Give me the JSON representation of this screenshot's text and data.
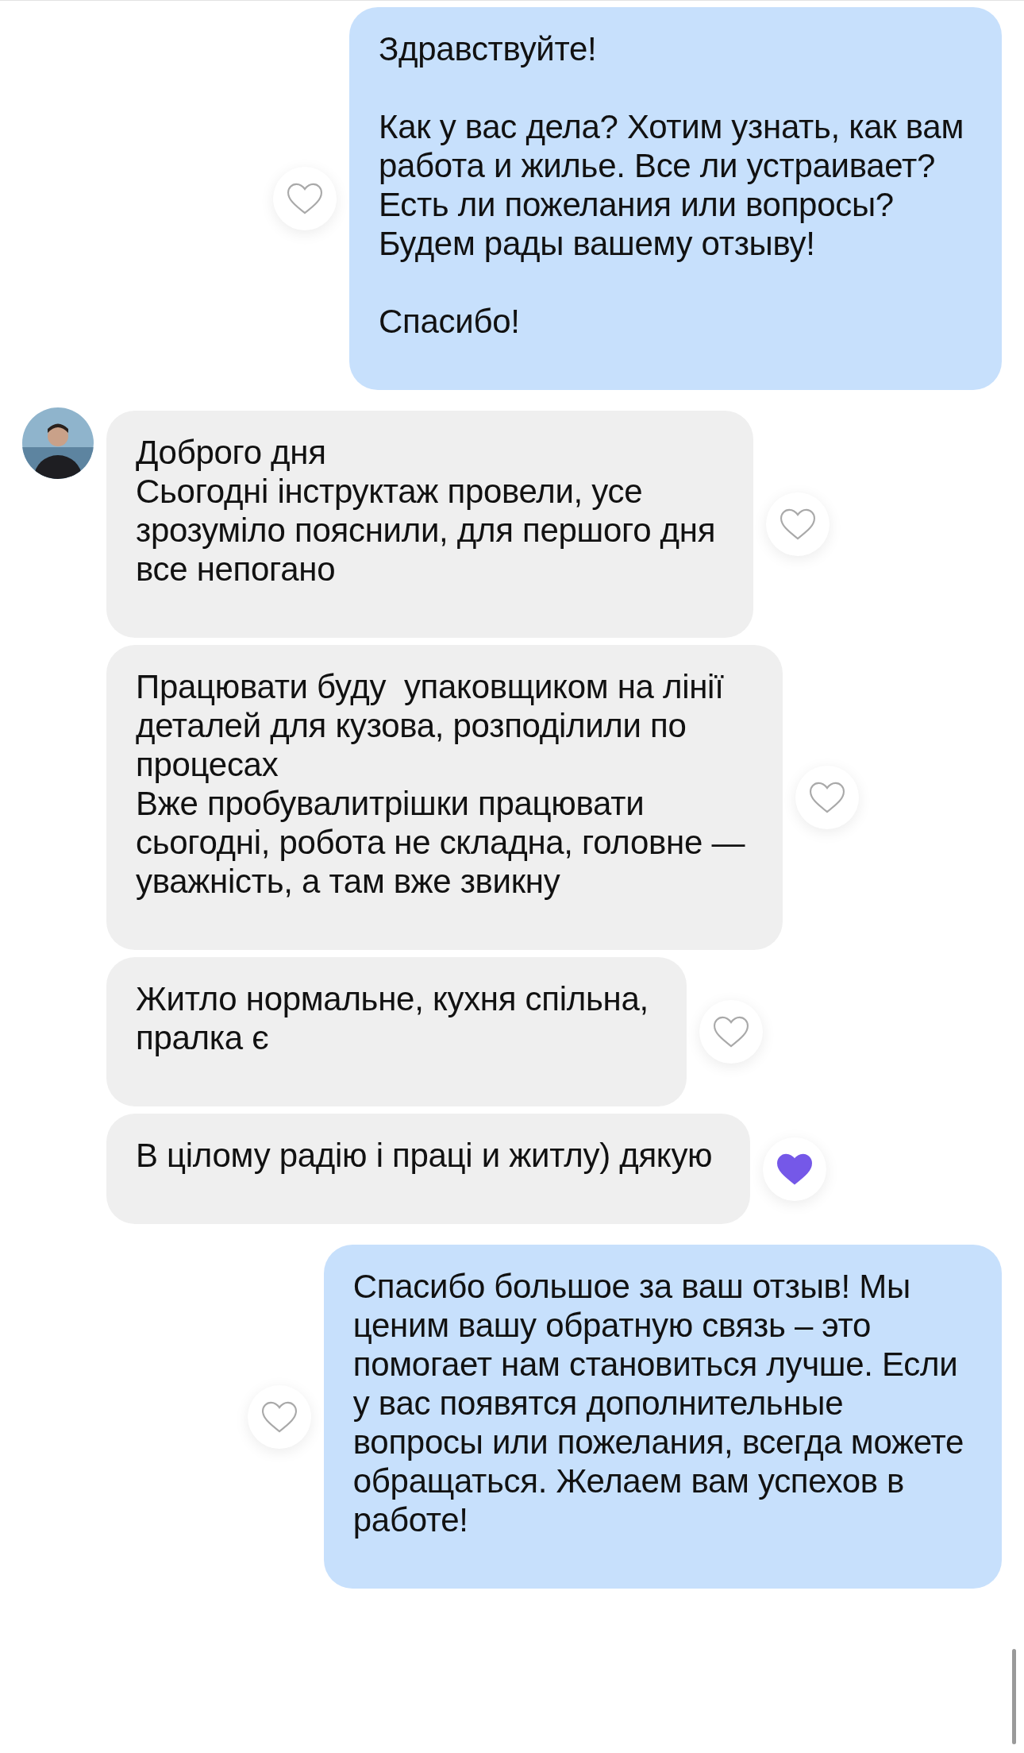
{
  "messages": [
    {
      "kind": "outgoing",
      "avatar": false,
      "liked": false,
      "text": "Здравствуйте!\n\nКак у вас дела? Хотим узнать, как вам\nработа и жилье. Все ли устраивает?\nЕсть ли пожелания или вопросы?\nБудем рады вашему отзыву!\n\nСпасибо!"
    },
    {
      "kind": "incoming",
      "avatar": true,
      "liked": false,
      "text": "Доброго дня\nСьогодні інструктаж провели, усе\nзрозуміло пояснили, для першого дня\nвсе непогано"
    },
    {
      "kind": "incoming",
      "avatar": false,
      "liked": false,
      "text": "Працювати буду  упаковщиком на лінії\nдеталей для кузова, розподілили по\nпроцесах\nВже пробувалитрішки працювати\nсьогодні, робота не складна, головне —\nуважність, а там вже звикну"
    },
    {
      "kind": "incoming",
      "avatar": false,
      "liked": false,
      "text": "Житло нормальне, кухня спільна,\nпралка є"
    },
    {
      "kind": "incoming",
      "avatar": false,
      "liked": true,
      "text": "В цілому радію і праці и житлу) дякую"
    },
    {
      "kind": "outgoing",
      "avatar": false,
      "liked": false,
      "text": "Спасибо большое за ваш отзыв! Мы\nценим вашу обратную связь – это\nпомогает нам становиться лучше. Если\nу вас появятся дополнительные\nвопросы или пожелания, всегда можете\nобращаться. Желаем вам успехов в\nработе!"
    }
  ]
}
